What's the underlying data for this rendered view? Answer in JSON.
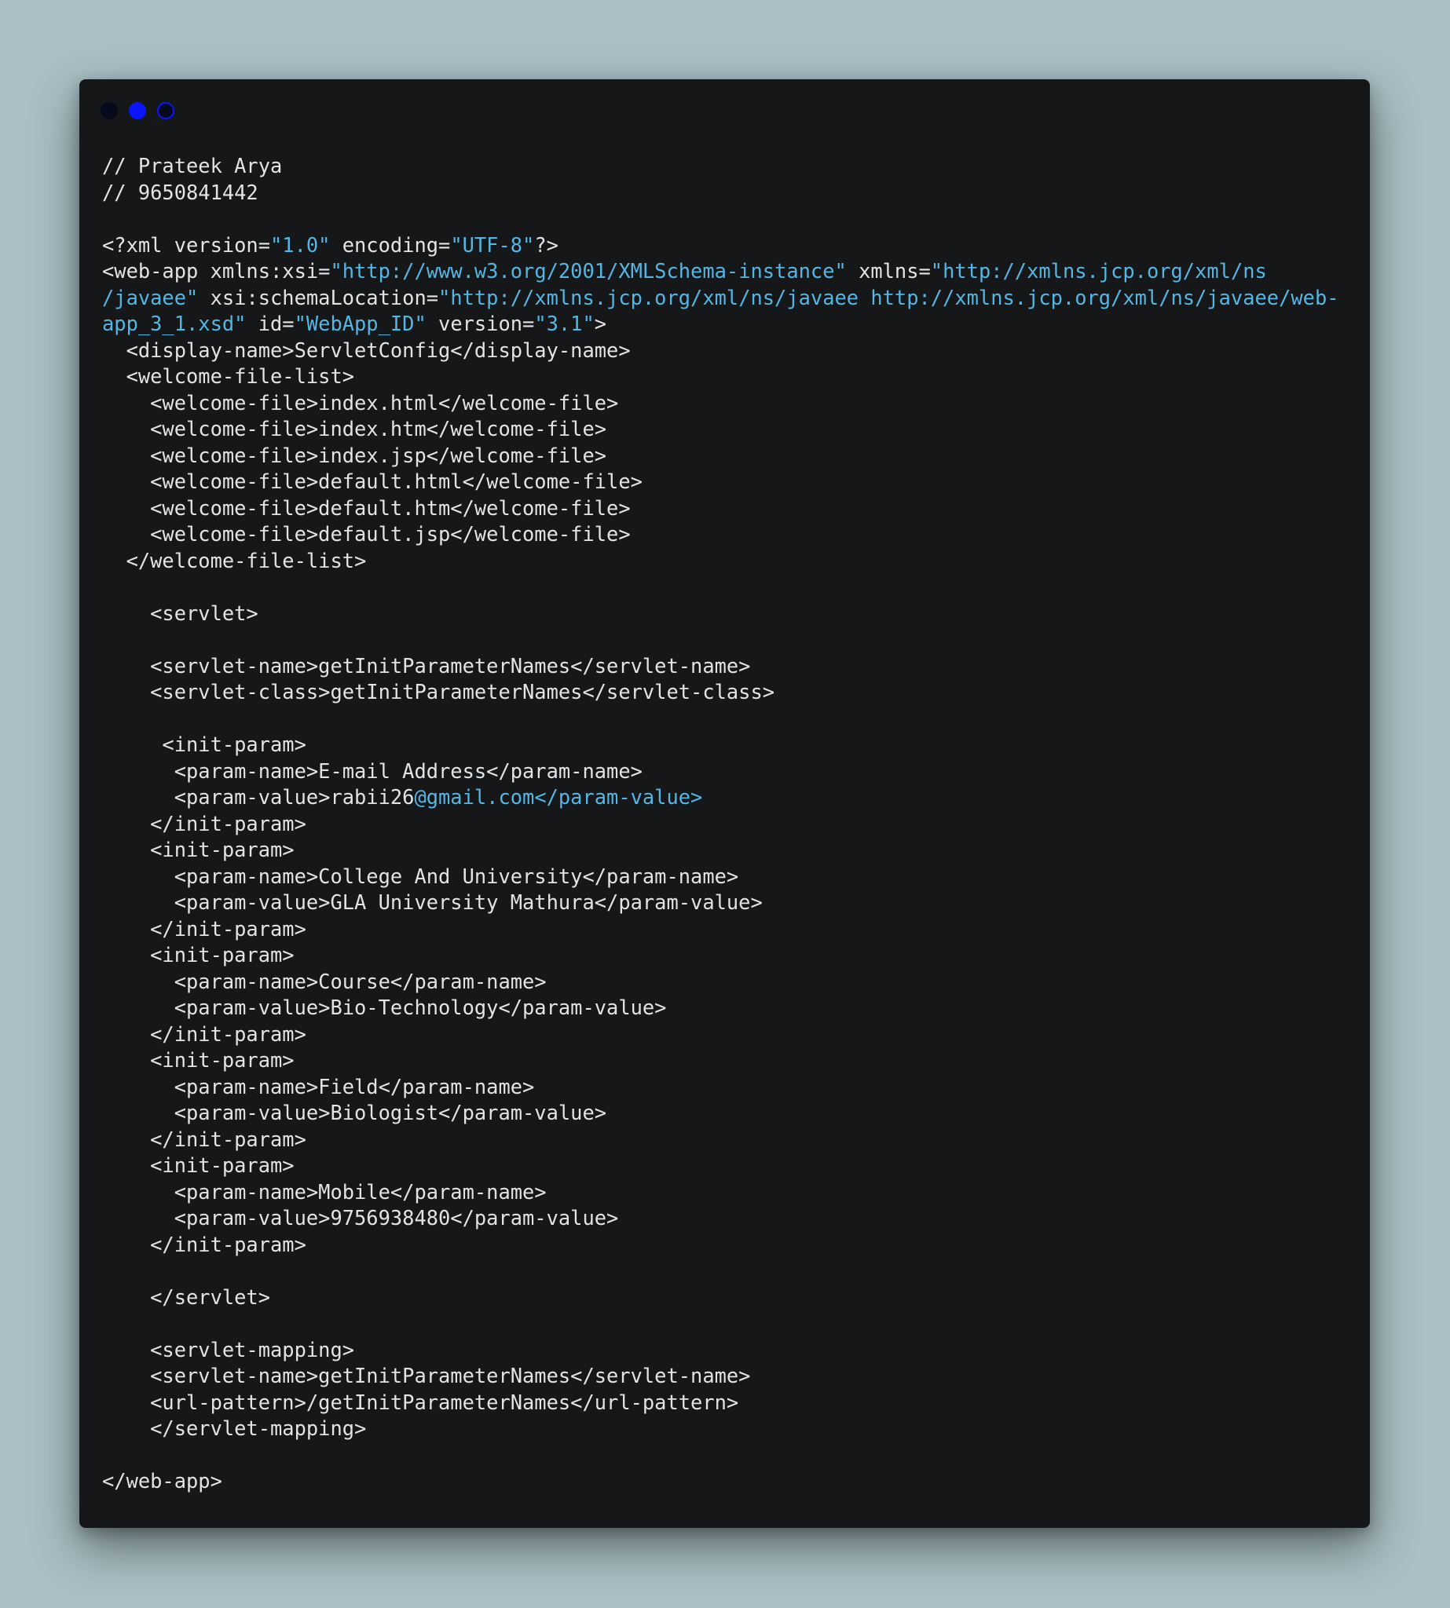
{
  "window": {
    "controls": [
      "close",
      "minimize",
      "maximize"
    ],
    "colors": {
      "background": "#151719",
      "text": "#e3e3e3",
      "string": "#55b6e3",
      "page": "#a9bfc4"
    }
  },
  "code": {
    "lines": [
      [
        {
          "t": "// Prateek Arya",
          "c": "plain"
        }
      ],
      [
        {
          "t": "// 9650841442",
          "c": "plain"
        }
      ],
      [],
      [
        {
          "t": "<?xml version=",
          "c": "plain"
        },
        {
          "t": "\"1.0\"",
          "c": "string"
        },
        {
          "t": " encoding=",
          "c": "plain"
        },
        {
          "t": "\"UTF-8\"",
          "c": "string"
        },
        {
          "t": "?>",
          "c": "plain"
        }
      ],
      [
        {
          "t": "<web-app xmlns:xsi=",
          "c": "plain"
        },
        {
          "t": "\"http://www.w3.org/2001/XMLSchema-instance\"",
          "c": "string"
        },
        {
          "t": " xmlns=",
          "c": "plain"
        },
        {
          "t": "\"http://xmlns.jcp.org/xml/ns",
          "c": "string"
        }
      ],
      [
        {
          "t": "/javaee\"",
          "c": "string"
        },
        {
          "t": " xsi:schemaLocation=",
          "c": "plain"
        },
        {
          "t": "\"http://xmlns.jcp.org/xml/ns/javaee http://xmlns.jcp.org/xml/ns/javaee/web-",
          "c": "string"
        }
      ],
      [
        {
          "t": "app_3_1.xsd\"",
          "c": "string"
        },
        {
          "t": " id=",
          "c": "plain"
        },
        {
          "t": "\"WebApp_ID\"",
          "c": "string"
        },
        {
          "t": " version=",
          "c": "plain"
        },
        {
          "t": "\"3.1\"",
          "c": "string"
        },
        {
          "t": ">",
          "c": "plain"
        }
      ],
      [
        {
          "t": "  <display-name>ServletConfig</display-name>",
          "c": "plain"
        }
      ],
      [
        {
          "t": "  <welcome-file-list>",
          "c": "plain"
        }
      ],
      [
        {
          "t": "    <welcome-file>index.html</welcome-file>",
          "c": "plain"
        }
      ],
      [
        {
          "t": "    <welcome-file>index.htm</welcome-file>",
          "c": "plain"
        }
      ],
      [
        {
          "t": "    <welcome-file>index.jsp</welcome-file>",
          "c": "plain"
        }
      ],
      [
        {
          "t": "    <welcome-file>default.html</welcome-file>",
          "c": "plain"
        }
      ],
      [
        {
          "t": "    <welcome-file>default.htm</welcome-file>",
          "c": "plain"
        }
      ],
      [
        {
          "t": "    <welcome-file>default.jsp</welcome-file>",
          "c": "plain"
        }
      ],
      [
        {
          "t": "  </welcome-file-list>",
          "c": "plain"
        }
      ],
      [],
      [
        {
          "t": "    <servlet>",
          "c": "plain"
        }
      ],
      [],
      [
        {
          "t": "    <servlet-name>getInitParameterNames</servlet-name>",
          "c": "plain"
        }
      ],
      [
        {
          "t": "    <servlet-class>getInitParameterNames</servlet-class>",
          "c": "plain"
        }
      ],
      [],
      [
        {
          "t": "     <init-param>",
          "c": "plain"
        }
      ],
      [
        {
          "t": "      <param-name>E-mail Address</param-name>",
          "c": "plain"
        }
      ],
      [
        {
          "t": "      <param-value>rabii26",
          "c": "plain"
        },
        {
          "t": "@gmail.com</param-value>",
          "c": "string"
        }
      ],
      [
        {
          "t": "    </init-param>",
          "c": "plain"
        }
      ],
      [
        {
          "t": "    <init-param>",
          "c": "plain"
        }
      ],
      [
        {
          "t": "      <param-name>College And University</param-name>",
          "c": "plain"
        }
      ],
      [
        {
          "t": "      <param-value>GLA University Mathura</param-value>",
          "c": "plain"
        }
      ],
      [
        {
          "t": "    </init-param>",
          "c": "plain"
        }
      ],
      [
        {
          "t": "    <init-param>",
          "c": "plain"
        }
      ],
      [
        {
          "t": "      <param-name>Course</param-name>",
          "c": "plain"
        }
      ],
      [
        {
          "t": "      <param-value>Bio-Technology</param-value>",
          "c": "plain"
        }
      ],
      [
        {
          "t": "    </init-param>",
          "c": "plain"
        }
      ],
      [
        {
          "t": "    <init-param>",
          "c": "plain"
        }
      ],
      [
        {
          "t": "      <param-name>Field</param-name>",
          "c": "plain"
        }
      ],
      [
        {
          "t": "      <param-value>Biologist</param-value>",
          "c": "plain"
        }
      ],
      [
        {
          "t": "    </init-param>",
          "c": "plain"
        }
      ],
      [
        {
          "t": "    <init-param>",
          "c": "plain"
        }
      ],
      [
        {
          "t": "      <param-name>Mobile</param-name>",
          "c": "plain"
        }
      ],
      [
        {
          "t": "      <param-value>9756938480</param-value>",
          "c": "plain"
        }
      ],
      [
        {
          "t": "    </init-param>",
          "c": "plain"
        }
      ],
      [],
      [
        {
          "t": "    </servlet>",
          "c": "plain"
        }
      ],
      [],
      [
        {
          "t": "    <servlet-mapping>",
          "c": "plain"
        }
      ],
      [
        {
          "t": "    <servlet-name>getInitParameterNames</servlet-name>",
          "c": "plain"
        }
      ],
      [
        {
          "t": "    <url-pattern>/getInitParameterNames</url-pattern>",
          "c": "plain"
        }
      ],
      [
        {
          "t": "    </servlet-mapping>",
          "c": "plain"
        }
      ],
      [],
      [
        {
          "t": "</web-app>",
          "c": "plain"
        }
      ]
    ]
  }
}
